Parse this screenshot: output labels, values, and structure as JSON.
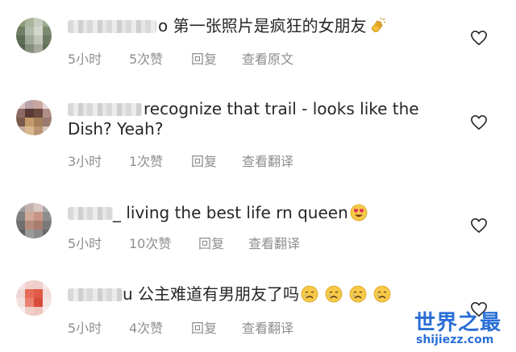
{
  "comments": [
    {
      "text": "o 第一张照片是疯狂的女朋友",
      "emoji": [
        "clapping-hands"
      ],
      "time": "5小时",
      "likes": "5次赞",
      "reply": "回复",
      "action": "查看原文"
    },
    {
      "text_line1": "recognize that trail - looks like the",
      "text_line2": "Dish? Yeah?",
      "time": "3小时",
      "likes": "1次赞",
      "reply": "回复",
      "action": "查看翻译"
    },
    {
      "text": "_ living the best life rn queen",
      "emoji": [
        "heart-eyes"
      ],
      "time": "5小时",
      "likes": "10次赞",
      "reply": "回复",
      "action": "查看翻译"
    },
    {
      "text": "u 公主难道有男朋友了吗",
      "emoji": [
        "crying-face",
        "crying-face",
        "crying-face",
        "crying-face"
      ],
      "time": "5小时",
      "likes": "4次赞",
      "reply": "回复",
      "action": "查看翻译"
    }
  ],
  "watermark": {
    "title": "世界之最",
    "url": "shijiezz.com"
  },
  "colors": {
    "text": "#262626",
    "meta": "#8e8e8e",
    "watermark": "#2a6fd6"
  }
}
